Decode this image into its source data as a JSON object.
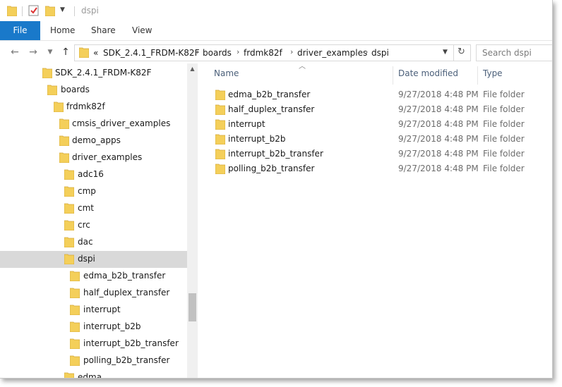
{
  "window": {
    "title": "dspi"
  },
  "ribbon": {
    "tabs": [
      {
        "label": "File"
      },
      {
        "label": "Home"
      },
      {
        "label": "Share"
      },
      {
        "label": "View"
      }
    ]
  },
  "address_bar": {
    "overflow": "«",
    "crumbs": [
      "SDK_2.4.1_FRDM-K82F",
      "boards",
      "frdmk82f",
      "driver_examples",
      "dspi"
    ]
  },
  "search": {
    "placeholder": "Search dspi"
  },
  "tree": {
    "items": [
      {
        "label": "SDK_2.4.1_FRDM-K82F"
      },
      {
        "label": "boards"
      },
      {
        "label": "frdmk82f"
      },
      {
        "label": "cmsis_driver_examples"
      },
      {
        "label": "demo_apps"
      },
      {
        "label": "driver_examples"
      },
      {
        "label": "adc16"
      },
      {
        "label": "cmp"
      },
      {
        "label": "cmt"
      },
      {
        "label": "crc"
      },
      {
        "label": "dac"
      },
      {
        "label": "dspi"
      },
      {
        "label": "edma_b2b_transfer"
      },
      {
        "label": "half_duplex_transfer"
      },
      {
        "label": "interrupt"
      },
      {
        "label": "interrupt_b2b"
      },
      {
        "label": "interrupt_b2b_transfer"
      },
      {
        "label": "polling_b2b_transfer"
      },
      {
        "label": "edma"
      }
    ],
    "selected": "dspi"
  },
  "columns": {
    "name": "Name",
    "date": "Date modified",
    "type": "Type"
  },
  "files": [
    {
      "name": "edma_b2b_transfer",
      "date": "9/27/2018 4:48 PM",
      "type": "File folder"
    },
    {
      "name": "half_duplex_transfer",
      "date": "9/27/2018 4:48 PM",
      "type": "File folder"
    },
    {
      "name": "interrupt",
      "date": "9/27/2018 4:48 PM",
      "type": "File folder"
    },
    {
      "name": "interrupt_b2b",
      "date": "9/27/2018 4:48 PM",
      "type": "File folder"
    },
    {
      "name": "interrupt_b2b_transfer",
      "date": "9/27/2018 4:48 PM",
      "type": "File folder"
    },
    {
      "name": "polling_b2b_transfer",
      "date": "9/27/2018 4:48 PM",
      "type": "File folder"
    }
  ],
  "colors": {
    "file_tab": "#1979ca",
    "folder": "#f4cf5a",
    "selection": "#d9d9d9"
  }
}
